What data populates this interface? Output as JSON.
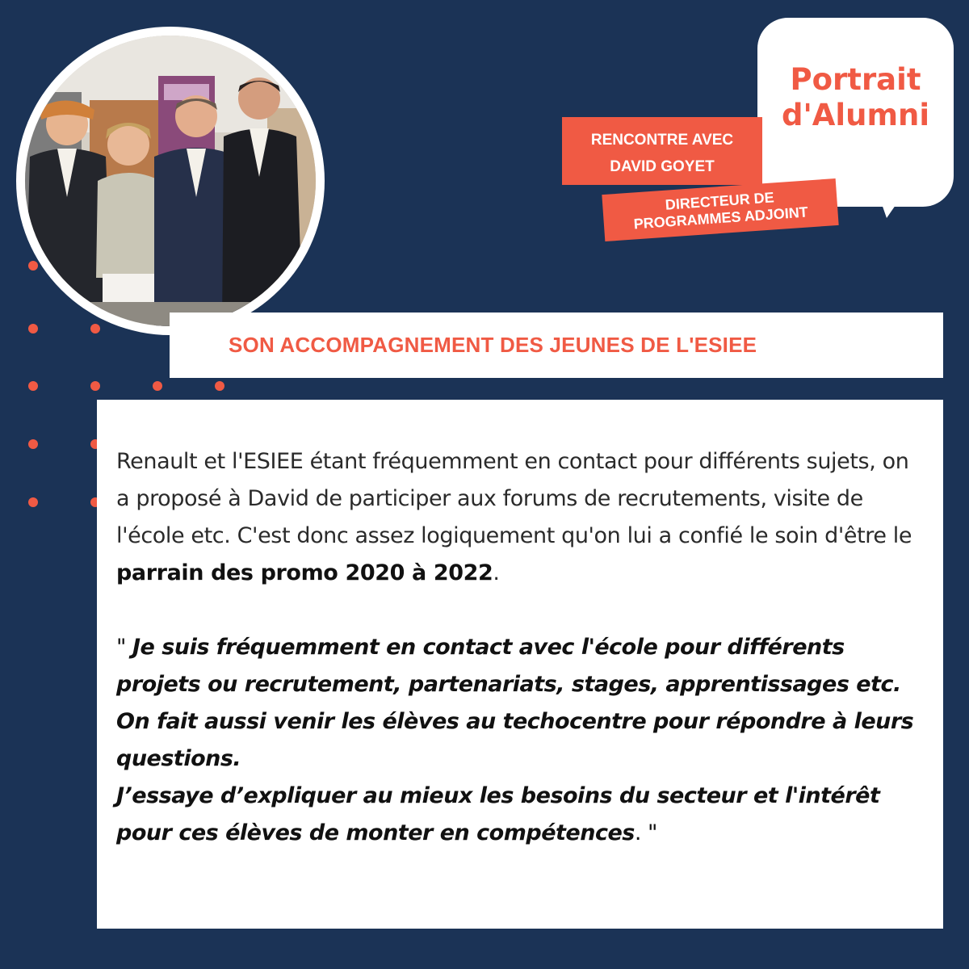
{
  "header": {
    "bubble_title_line1": "Portrait",
    "bubble_title_line2": "d'Alumni",
    "name_tag_line1": "RENCONTRE AVEC",
    "name_tag_line2": "DAVID GOYET",
    "role_tag_line1": "DIRECTEUR DE",
    "role_tag_line2": "PROGRAMMES ADJOINT"
  },
  "section": {
    "title": "SON ACCOMPAGNEMENT DES JEUNES DE L'ESIEE"
  },
  "body": {
    "intro": "Renault et l'ESIEE étant fréquemment en contact pour différents sujets, on a proposé à David de participer aux forums de recrutements, visite de l'école etc. C'est donc assez logiquement qu'on lui a confié le soin d'être le ",
    "intro_bold": "parrain des promo 2020 à 2022",
    "intro_end": ".",
    "quote_open": "\" ",
    "quote_part1": "Je suis fréquemment en contact avec l'école pour différents projets ou recrutement, partenariats, stages, apprentissages etc. On fait aussi venir les élèves au techocentre pour répondre à leurs questions.",
    "quote_part2": "J’essaye d’expliquer au mieux les besoins du secteur et l'intérêt pour ces élèves de monter en compétences",
    "quote_close": ". \""
  },
  "colors": {
    "background": "#1b3356",
    "accent": "#f05a44",
    "panel": "#ffffff"
  },
  "icons": {
    "speech_bubble": "speech-bubble-icon"
  }
}
